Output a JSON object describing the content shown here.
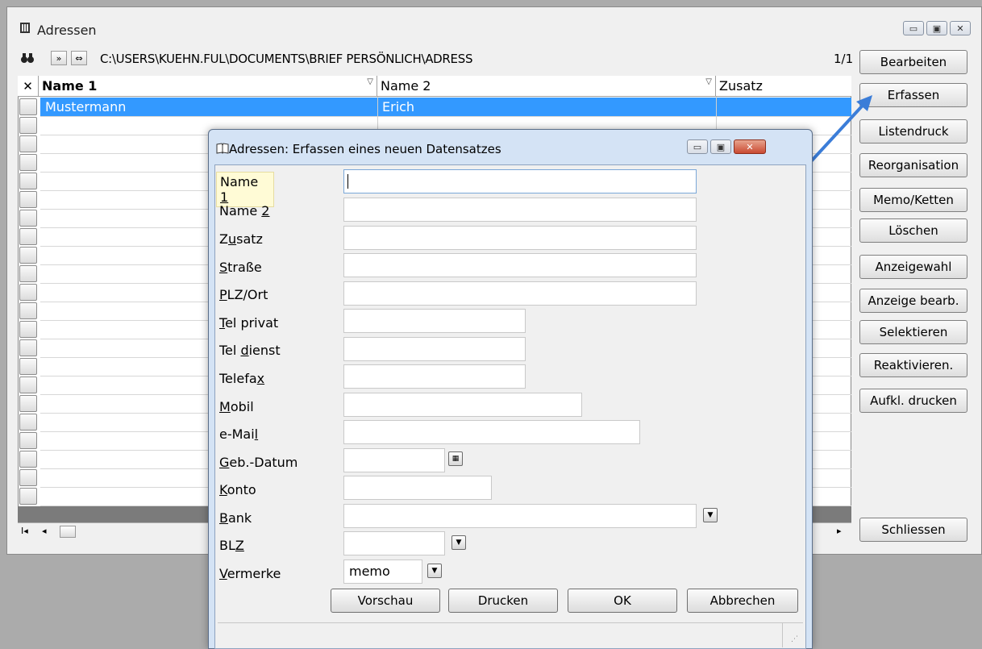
{
  "window": {
    "title": "Adressen",
    "path": "C:\\USERS\\KUEHN.FUL\\DOCUMENTS\\BRIEF PERSÖNLICH\\ADRESS",
    "page_count": "1/1",
    "controls": [
      "minimize-icon",
      "maximize-icon",
      "close-icon"
    ]
  },
  "toolbar": {
    "icons": [
      "binoculars-icon",
      "forward-icon",
      "swap-icon"
    ]
  },
  "grid": {
    "corner": "✕",
    "columns": [
      "Name 1",
      "Name 2",
      "Zusatz"
    ],
    "rows": [
      [
        "Mustermann",
        "Erich",
        ""
      ]
    ]
  },
  "sidebar": {
    "buttons": [
      "Bearbeiten",
      "Erfassen",
      "Listendruck",
      "Reorganisation",
      "Memo/Ketten",
      "Löschen",
      "Anzeigewahl",
      "Anzeige bearb.",
      "Selektieren",
      "Reaktivieren.",
      "Aufkl. drucken"
    ],
    "close_label": "Schliessen"
  },
  "dialog": {
    "title": "Adressen: Erfassen eines neuen Datensatzes",
    "fields": [
      {
        "pre": "Name ",
        "u": "1",
        "post": "",
        "value": ""
      },
      {
        "pre": "Name ",
        "u": "2",
        "post": "",
        "value": ""
      },
      {
        "pre": "Z",
        "u": "u",
        "post": "satz",
        "value": ""
      },
      {
        "pre": "",
        "u": "S",
        "post": "traße",
        "value": ""
      },
      {
        "pre": "",
        "u": "P",
        "post": "LZ/Ort",
        "value": ""
      },
      {
        "pre": "",
        "u": "T",
        "post": "el privat",
        "value": ""
      },
      {
        "pre": "Tel ",
        "u": "d",
        "post": "ienst",
        "value": ""
      },
      {
        "pre": "Telefa",
        "u": "x",
        "post": "",
        "value": ""
      },
      {
        "pre": "",
        "u": "M",
        "post": "obil",
        "value": ""
      },
      {
        "pre": "e-Mai",
        "u": "l",
        "post": "",
        "value": ""
      },
      {
        "pre": "",
        "u": "G",
        "post": "eb.-Datum",
        "value": ""
      },
      {
        "pre": "",
        "u": "K",
        "post": "onto",
        "value": ""
      },
      {
        "pre": "",
        "u": "B",
        "post": "ank",
        "value": ""
      },
      {
        "pre": "BL",
        "u": "Z",
        "post": "",
        "value": ""
      },
      {
        "pre": "",
        "u": "V",
        "post": "ermerke",
        "value": "memo"
      }
    ],
    "buttons": {
      "preview": "Vorschau",
      "print": "Drucken",
      "ok": "OK",
      "cancel": "Abbrechen"
    }
  },
  "colors": {
    "selection": "#3399ff",
    "annotation_arrow": "#3b7dd8"
  }
}
